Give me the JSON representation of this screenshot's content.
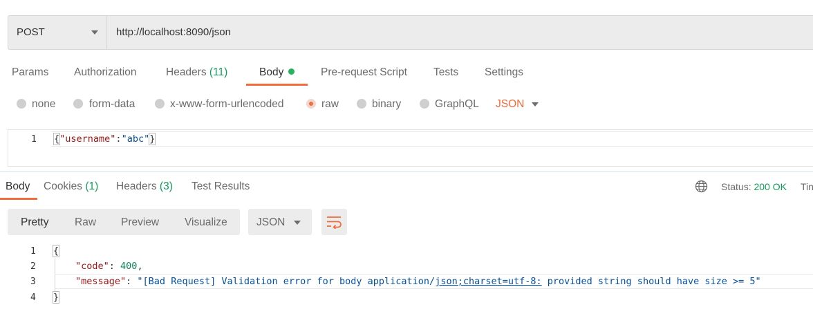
{
  "request": {
    "method": "POST",
    "url": "http://localhost:8090/json"
  },
  "request_tabs": [
    {
      "label": "Params"
    },
    {
      "label": "Authorization"
    },
    {
      "label": "Headers",
      "count": "(11)"
    },
    {
      "label": "Body"
    },
    {
      "label": "Pre-request Script"
    },
    {
      "label": "Tests"
    },
    {
      "label": "Settings"
    }
  ],
  "body_types": {
    "none": "none",
    "form_data": "form-data",
    "urlencoded": "x-www-form-urlencoded",
    "raw": "raw",
    "binary": "binary",
    "graphql": "GraphQL",
    "format": "JSON"
  },
  "request_body": {
    "line_number": "1",
    "open": "{",
    "key": "\"username\"",
    "colon": ":",
    "value": "\"abc\"",
    "close": "}"
  },
  "response_tabs": [
    {
      "label": "Body"
    },
    {
      "label": "Cookies",
      "count": "(1)"
    },
    {
      "label": "Headers",
      "count": "(3)"
    },
    {
      "label": "Test Results"
    }
  ],
  "response_status": {
    "label": "Status:",
    "value": "200 OK",
    "time_label": "Tin"
  },
  "view_modes": [
    "Pretty",
    "Raw",
    "Preview",
    "Visualize"
  ],
  "response_format": "JSON",
  "response_body": {
    "line_numbers": [
      "1",
      "2",
      "3",
      "4"
    ],
    "open": "{",
    "code_key": "\"code\"",
    "code_value": "400",
    "message_key": "\"message\"",
    "message_prefix": "\"[Bad Request] Validation error for body application/",
    "message_link": "json;charset=utf-8:",
    "message_suffix": " provided string should have size >= 5\"",
    "close": "}"
  },
  "colors": {
    "accent": "#f26b3a",
    "success": "#0f9d58",
    "code_key": "#a31515",
    "code_string": "#0451a5",
    "code_number": "#098658"
  },
  "icons": [
    "chevron-down-icon",
    "globe-icon",
    "wrap-lines-icon"
  ]
}
